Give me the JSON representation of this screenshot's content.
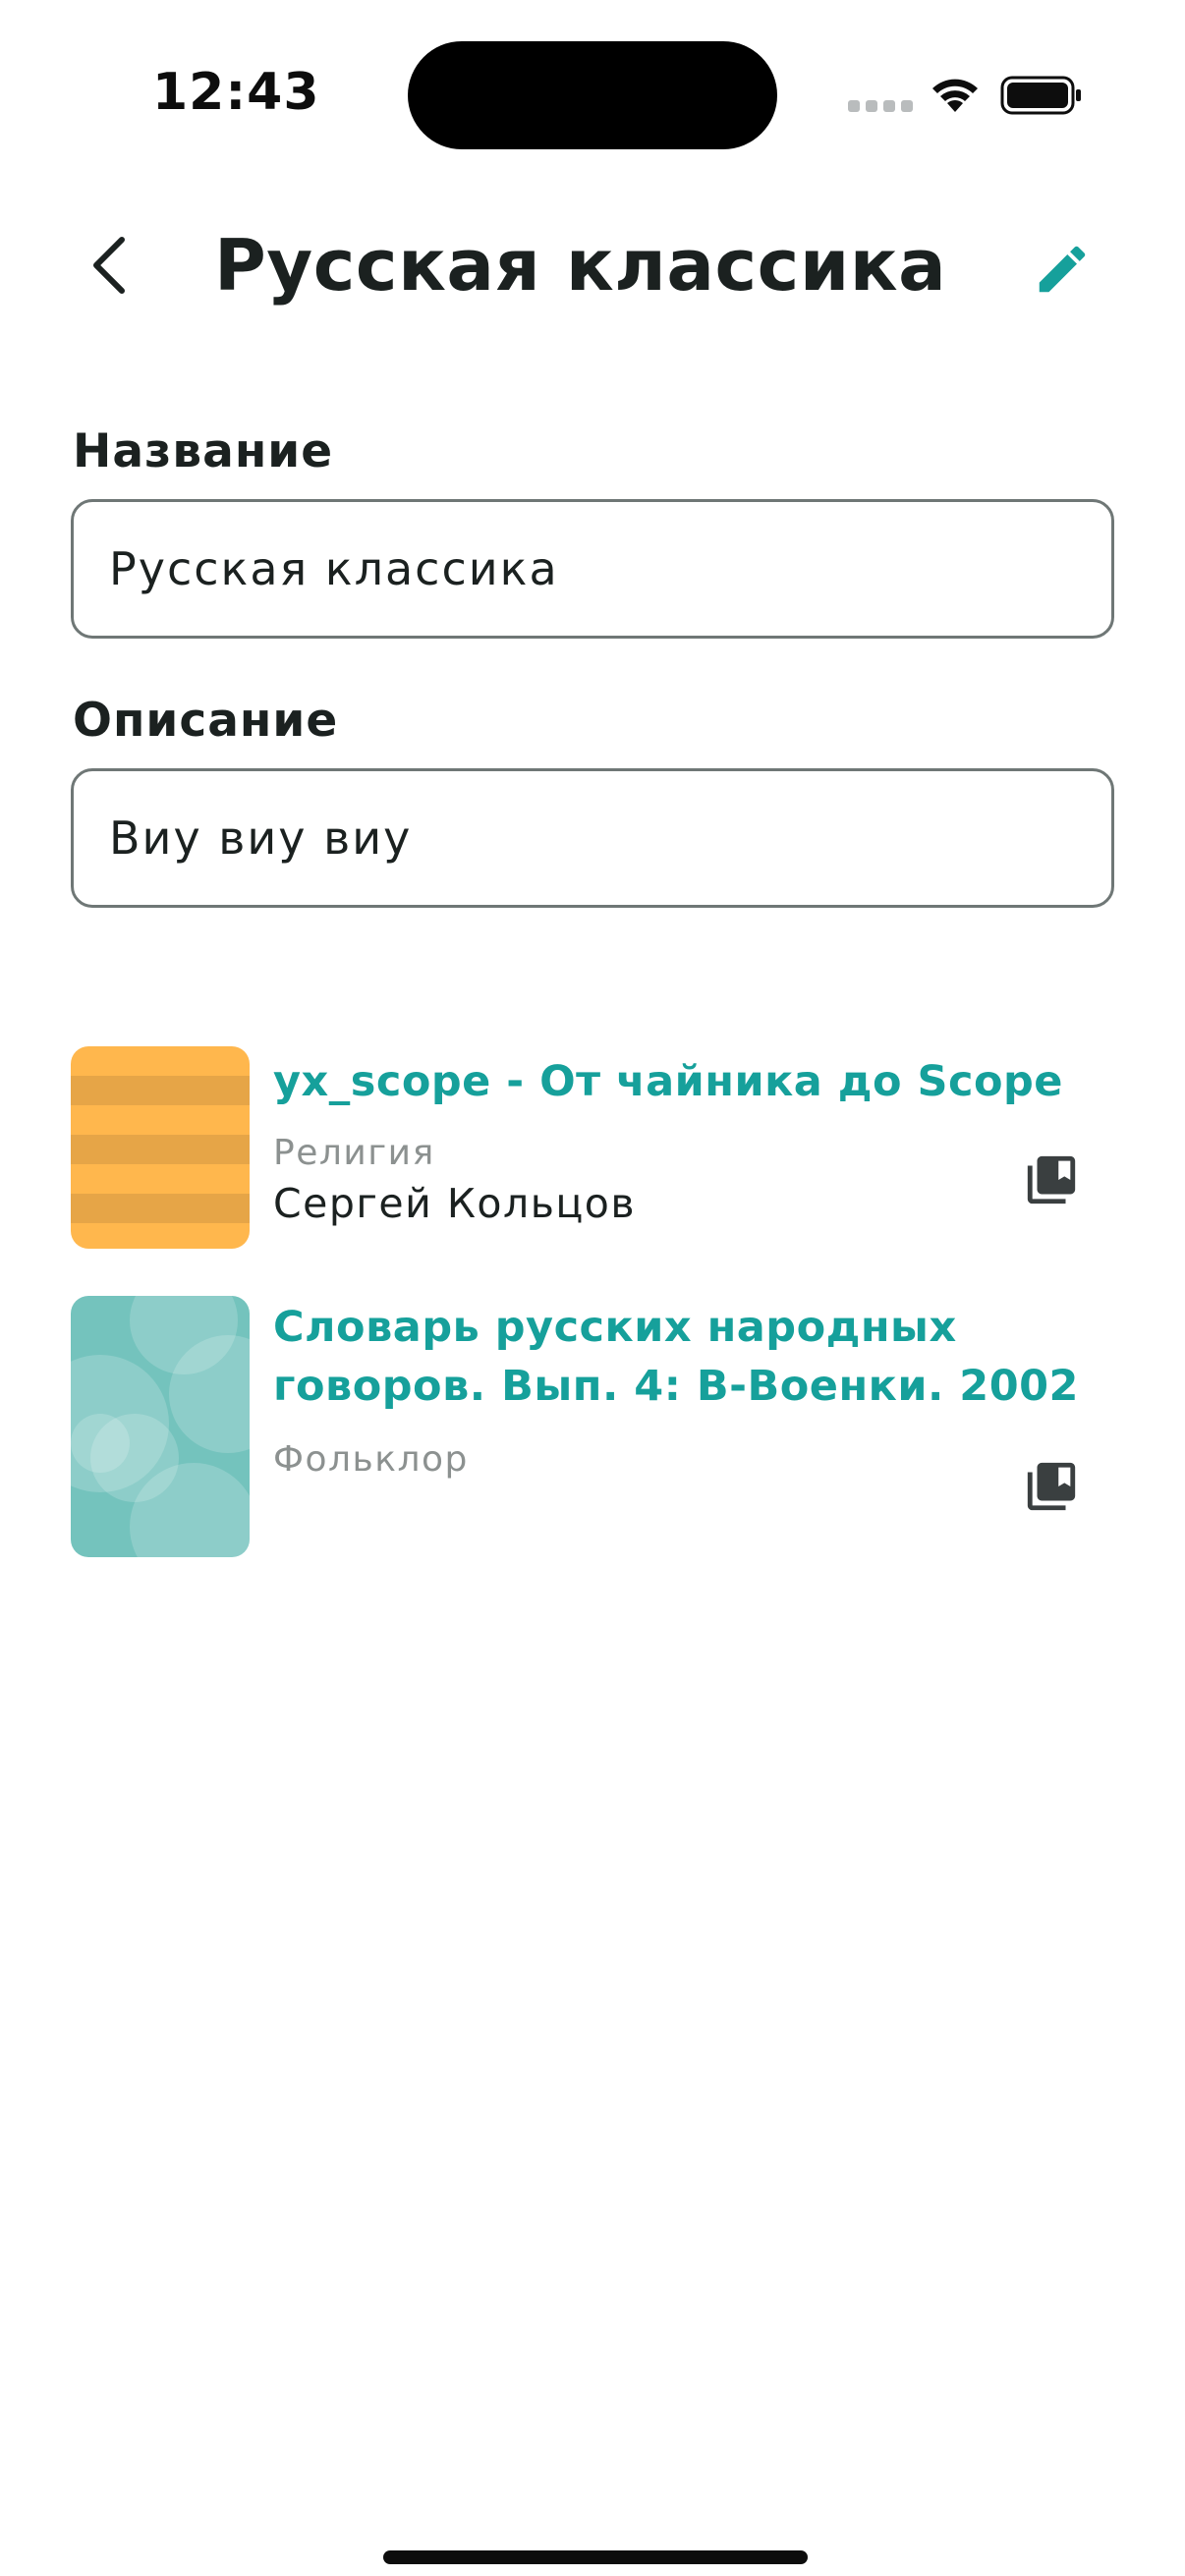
{
  "status_bar": {
    "time": "12:43"
  },
  "header": {
    "title": "Русская классика"
  },
  "form": {
    "name_label": "Название",
    "name_value": "Русская классика",
    "description_label": "Описание",
    "description_value": "Виу виу виу"
  },
  "books": [
    {
      "title": "yx_scope - От чайника до Scope",
      "genre": "Религия",
      "author": "Сергей Кольцов",
      "cover": "orange-stripes"
    },
    {
      "title": "Словарь русских народных говоров. Вып. 4: В-Военки. 2002",
      "genre": "Фольклор",
      "author": "",
      "cover": "teal-bubbles"
    }
  ],
  "colors": {
    "accent": "#16a09b",
    "text": "#1b2120",
    "muted": "#8c9190",
    "border": "#6f7776",
    "cover_orange": "#ffb74d",
    "cover_teal": "#74c3bd"
  },
  "icons": {
    "back": "chevron-left-icon",
    "edit": "pencil-icon",
    "library": "library-books-icon",
    "wifi": "wifi-icon",
    "battery": "battery-icon"
  }
}
